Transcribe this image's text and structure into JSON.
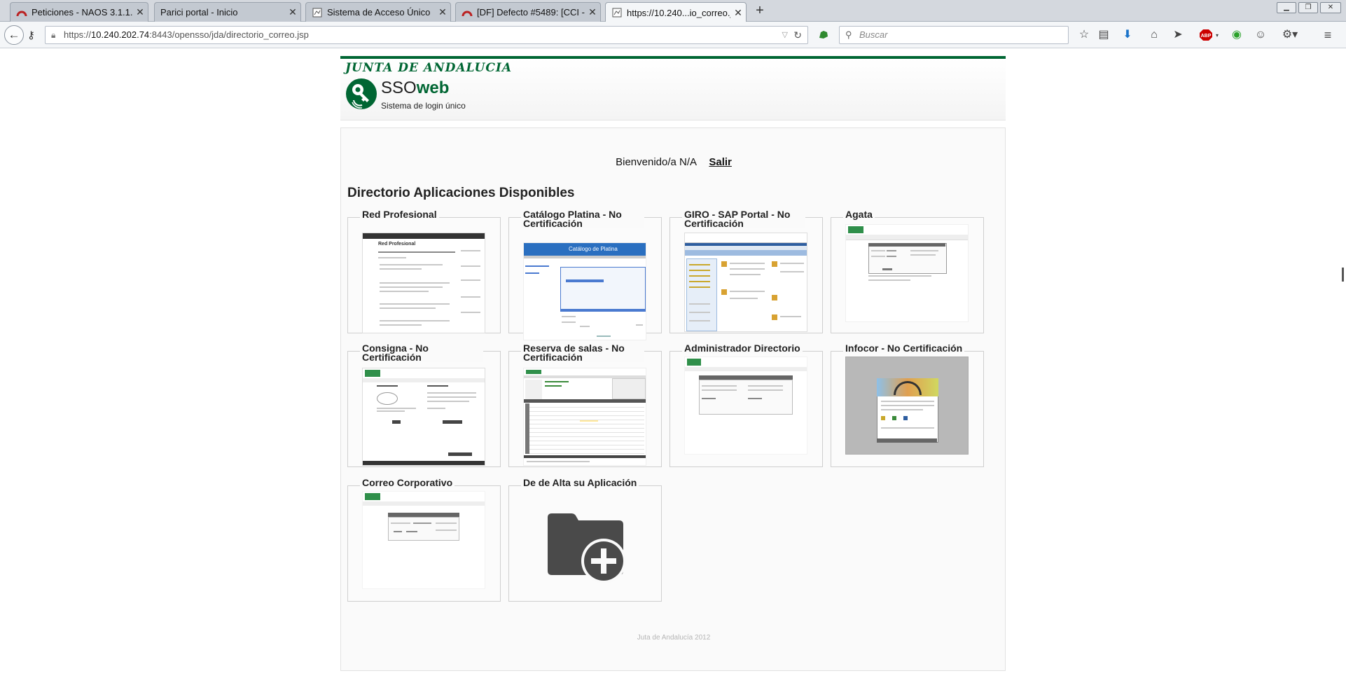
{
  "browser": {
    "tabs": [
      {
        "label": "Peticiones - NAOS 3.1.1.0 -..."
      },
      {
        "label": "Parici portal - Inicio"
      },
      {
        "label": "Sistema de Acceso Único"
      },
      {
        "label": "[DF] Defecto #5489: [CCI - ..."
      },
      {
        "label": "https://10.240...io_correo.jsp"
      }
    ],
    "url_prefix": "https://",
    "url_host": "10.240.202.74",
    "url_rest": ":8443/opensso/jda/directorio_correo.jsp",
    "search_placeholder": "Buscar",
    "abp_label": "ABP"
  },
  "header": {
    "org": "JUNTA DE ANDALUCIA",
    "sso": "SSO",
    "web": "web",
    "subtitle": "Sistema de login único"
  },
  "welcome": {
    "text": "Bienvenido/a N/A",
    "logout": "Salir"
  },
  "directory": {
    "title": "Directorio Aplicaciones Disponibles",
    "apps": [
      {
        "title": "Red Profesional",
        "thumb": "red-profesional"
      },
      {
        "title": "Catálogo Platina - No Certificación",
        "thumb": "catalogo-platina"
      },
      {
        "title": "GIRO - SAP Portal - No Certificación",
        "thumb": "giro-sap"
      },
      {
        "title": "Agata",
        "thumb": "agata"
      },
      {
        "title": "Consigna - No Certificación",
        "thumb": "consigna"
      },
      {
        "title": "Reserva de salas - No Certificación",
        "thumb": "reserva-salas"
      },
      {
        "title": "Administrador Directorio",
        "thumb": "administrador-directorio"
      },
      {
        "title": "Infocor - No Certificación",
        "thumb": "infocor"
      },
      {
        "title": "Correo Corporativo",
        "thumb": "correo-corporativo"
      },
      {
        "title": "De de Alta su Aplicación",
        "thumb": "add-application"
      }
    ]
  },
  "thumb_texts": {
    "red_profesional": "Red Profesional",
    "catalogo": "Catálogo de Platina"
  },
  "footer": "Juta de Andalucía 2012",
  "colors": {
    "brand_green": "#006633",
    "folder": "#4a4a4a"
  }
}
